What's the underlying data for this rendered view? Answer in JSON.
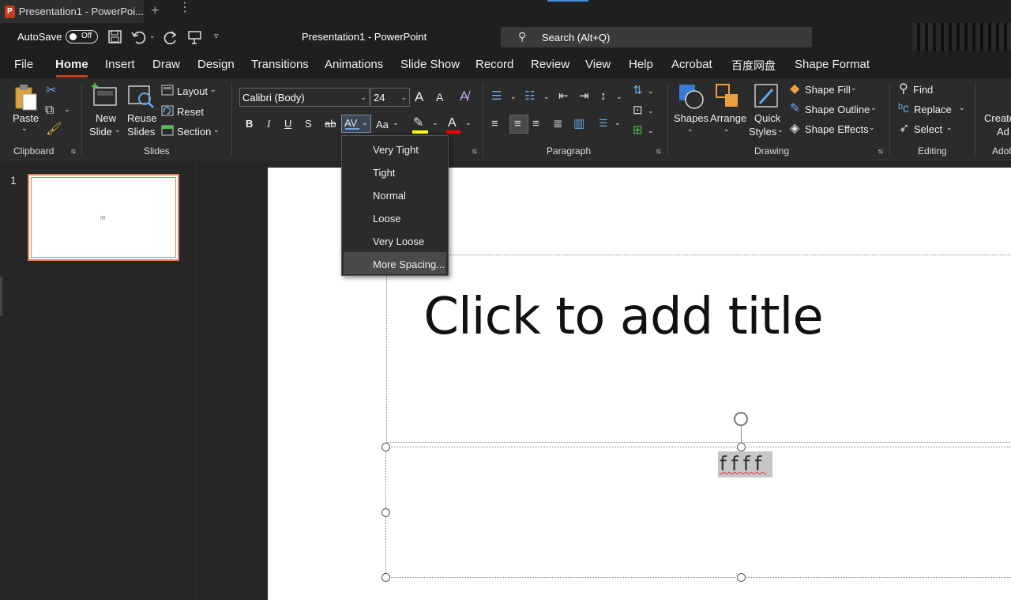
{
  "tabbar": {
    "tab_title": "Presentation1 - PowerPoi...",
    "app_badge": "P",
    "new_tab": "+",
    "more": "⋮"
  },
  "titlebar": {
    "autosave_label": "AutoSave",
    "autosave_state": "Off",
    "doc_title": "Presentation1  -  PowerPoint",
    "search_placeholder": "Search (Alt+Q)"
  },
  "menu": {
    "items": [
      "File",
      "Home",
      "Insert",
      "Draw",
      "Design",
      "Transitions",
      "Animations",
      "Slide Show",
      "Record",
      "Review",
      "View",
      "Help",
      "Acrobat",
      "百度网盘",
      "Shape Format"
    ]
  },
  "ribbon": {
    "clipboard": {
      "paste": "Paste",
      "group": "Clipboard"
    },
    "slides": {
      "new1": "New",
      "new2": "Slide",
      "reuse1": "Reuse",
      "reuse2": "Slides",
      "layout": "Layout",
      "reset": "Reset",
      "section": "Section",
      "group": "Slides"
    },
    "font": {
      "font_name": "Calibri (Body)",
      "font_size": "24",
      "bold": "B",
      "italic": "I",
      "underline": "U",
      "shadow": "S",
      "strike": "ab",
      "spacing": "AV",
      "case": "Aa",
      "color": "A",
      "grow": "A",
      "shrink": "A"
    },
    "paragraph": {
      "group": "Paragraph"
    },
    "drawing": {
      "shapes": "Shapes",
      "arrange": "Arrange",
      "quick1": "Quick",
      "quick2": "Styles",
      "fill": "Shape Fill",
      "outline": "Shape Outline",
      "effects": "Shape Effects",
      "group": "Drawing"
    },
    "editing": {
      "find": "Find",
      "replace": "Replace",
      "select": "Select",
      "group": "Editing"
    },
    "adobe": {
      "create1": "Create",
      "create2": "Ad",
      "group": "Adob"
    }
  },
  "spacing_menu": {
    "items": [
      "Very Tight",
      "Tight",
      "Normal",
      "Loose",
      "Very Loose",
      "More Spacing..."
    ],
    "selected": "More Spacing..."
  },
  "thumbnails": [
    {
      "number": "1",
      "text": "ffff"
    }
  ],
  "slide": {
    "title_placeholder": "Click to add title",
    "body_text": "ffff"
  },
  "colors": {
    "accent": "#c43e1c",
    "highlight": "#ffff00",
    "font_color": "#ff0000",
    "ribbon_bg": "#2b2b2b"
  }
}
